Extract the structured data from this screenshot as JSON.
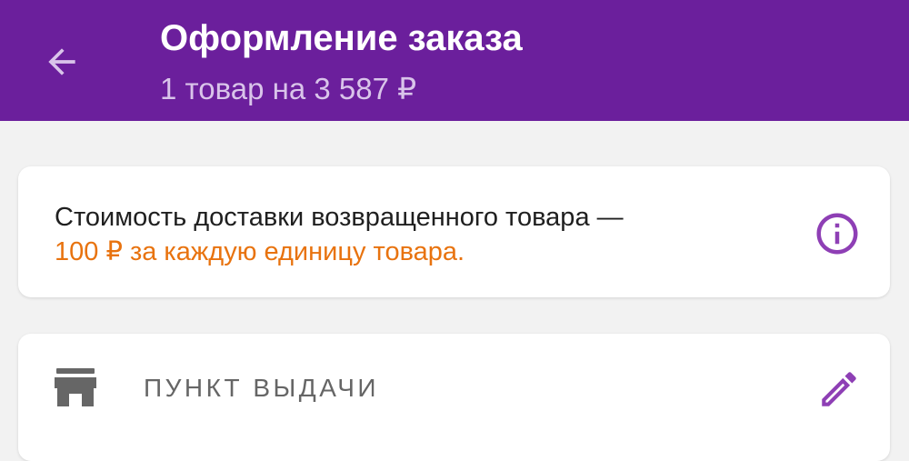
{
  "header": {
    "title": "Оформление заказа",
    "subtitle": "1 товар на 3 587 ₽",
    "back_icon": "arrow-left-icon",
    "background_color": "#6b1f9c"
  },
  "info_card": {
    "line1": "Стоимость доставки возвращенного товара —",
    "line2": "100 ₽ за каждую единицу товара.",
    "line2_color": "#e8730f",
    "icon": "info-icon"
  },
  "pickup_card": {
    "label": "ПУНКТ ВЫДАЧИ",
    "icon": "store-icon",
    "edit_icon": "pencil-icon"
  }
}
